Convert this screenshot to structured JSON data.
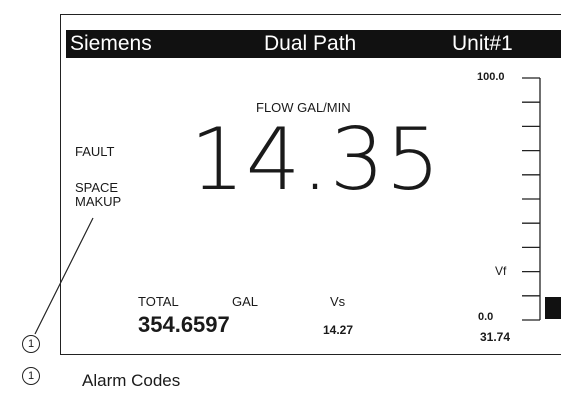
{
  "header": {
    "brand": "Siemens",
    "mode": "Dual Path",
    "unit": "Unit#1"
  },
  "measurement": {
    "label": "FLOW GAL/MIN",
    "value": "14.35"
  },
  "alarms": {
    "line1": "FAULT",
    "line2": "SPACE\nMAKUP"
  },
  "totals": {
    "total_label": "TOTAL",
    "total_unit": "GAL",
    "total_value": "354.6597",
    "vs_label": "Vs",
    "vs_value": "14.27"
  },
  "bar_scale": {
    "max_label": "100.0",
    "mid_label": "Vf",
    "min_label": "0.0",
    "reading": "31.74",
    "tick_count": 11
  },
  "callout": {
    "number": "1",
    "text": "Alarm Codes"
  }
}
